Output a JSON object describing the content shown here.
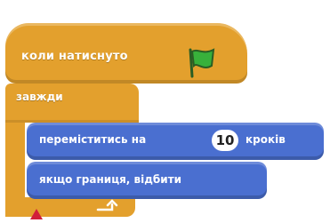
{
  "blocks": {
    "when_flag_clicked": {
      "label": "коли натиснуто"
    },
    "forever": {
      "label": "завжди"
    },
    "move_steps": {
      "label_before": "переміститись на",
      "steps": "10",
      "label_after": "кроків"
    },
    "bounce_on_edge": {
      "label": "якщо границя, відбити"
    }
  },
  "colors": {
    "events": "#e3a02d",
    "motion": "#4a6fd0",
    "flag": "#38b13b",
    "accent_red": "#d11f3a"
  },
  "icons": {
    "flag": "green-flag-icon",
    "loop": "loop-arrow-icon"
  }
}
